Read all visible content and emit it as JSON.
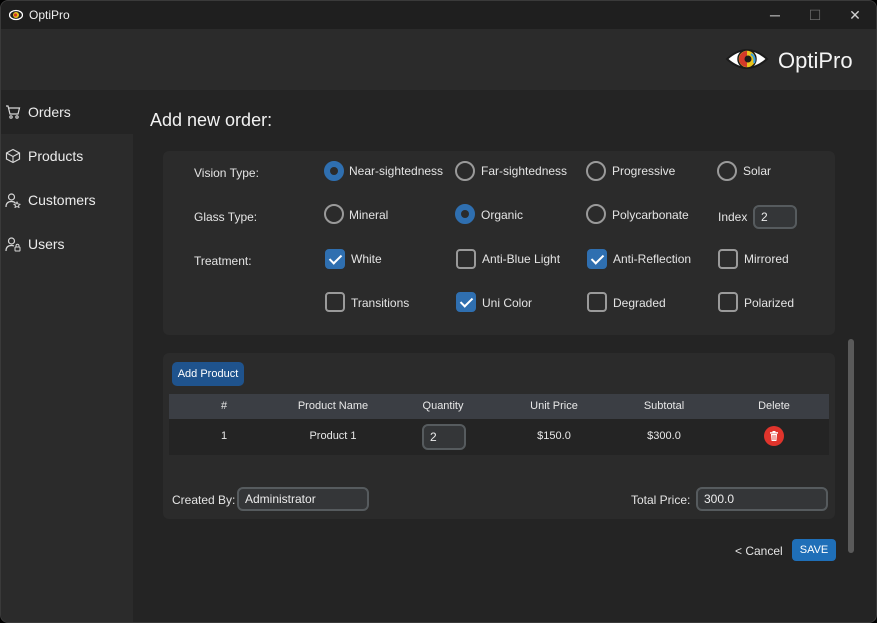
{
  "window": {
    "title": "OptiPro",
    "min_glyph": "─",
    "max_glyph": "☐",
    "close_glyph": "✕"
  },
  "header": {
    "logo_text": "OptiPro"
  },
  "sidebar": {
    "items": [
      {
        "label": "Orders",
        "icon": "cart-icon"
      },
      {
        "label": "Products",
        "icon": "box-icon"
      },
      {
        "label": "Customers",
        "icon": "customer-icon"
      },
      {
        "label": "Users",
        "icon": "user-lock-icon"
      }
    ],
    "active": "Orders"
  },
  "page": {
    "title": "Add new order:"
  },
  "options": {
    "vision": {
      "label": "Vision Type:",
      "choices": [
        "Near-sightedness",
        "Far-sightedness",
        "Progressive",
        "Solar"
      ],
      "selected": "Near-sightedness"
    },
    "glass": {
      "label": "Glass Type:",
      "choices": [
        "Mineral",
        "Organic",
        "Polycarbonate"
      ],
      "selected": "Organic",
      "index_label": "Index",
      "index_value": "2"
    },
    "treatment": {
      "label": "Treatment:",
      "items": [
        {
          "label": "White",
          "checked": true
        },
        {
          "label": "Anti-Blue Light",
          "checked": false
        },
        {
          "label": "Anti-Reflection",
          "checked": true
        },
        {
          "label": "Mirrored",
          "checked": false
        },
        {
          "label": "Transitions",
          "checked": false
        },
        {
          "label": "Uni Color",
          "checked": true
        },
        {
          "label": "Degraded",
          "checked": false
        },
        {
          "label": "Polarized",
          "checked": false
        }
      ]
    }
  },
  "products": {
    "add_label": "Add Product",
    "columns": [
      "#",
      "Product Name",
      "Quantity",
      "Unit Price",
      "Subtotal",
      "Delete"
    ],
    "rows": [
      {
        "num": "1",
        "name": "Product 1",
        "quantity": "2",
        "unit_price": "$150.0",
        "subtotal": "$300.0"
      }
    ],
    "created_by_label": "Created By:",
    "created_by_value": "Administrator",
    "total_label": "Total Price:",
    "total_value": "300.0"
  },
  "actions": {
    "cancel_label": "< Cancel",
    "save_label": "SAVE"
  },
  "colors": {
    "accent": "#1f6fb8",
    "danger": "#e0342c",
    "background": "#242424",
    "panel": "#2b2b2b"
  }
}
